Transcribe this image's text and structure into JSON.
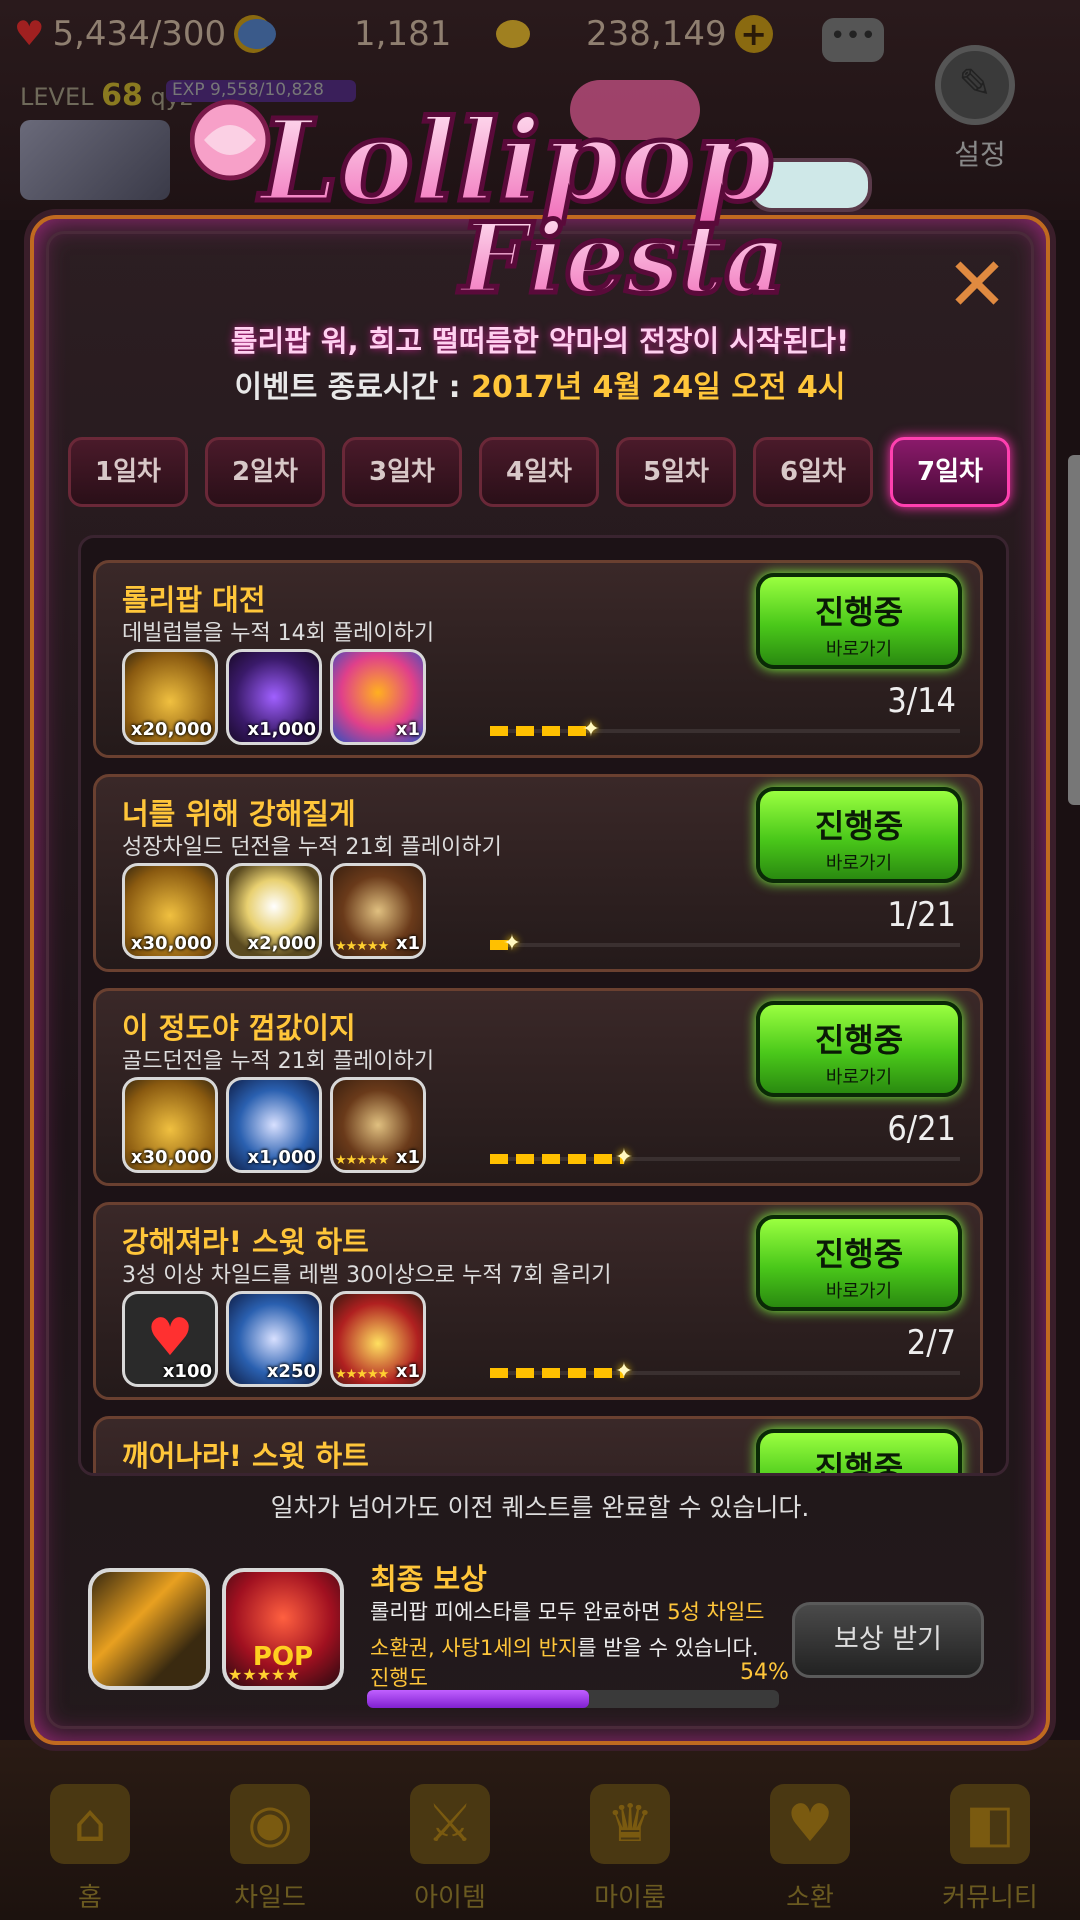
{
  "hud": {
    "hearts": "5,434/300",
    "gems": "1,181",
    "gold": "238,149",
    "level_label": "LEVEL",
    "level": "68",
    "username": "qyz",
    "exp": "EXP 9,558/10,828",
    "settings_label": "설정"
  },
  "event": {
    "logo_line1": "Lollipop",
    "logo_line2": "Fiesta",
    "subtitle": "롤리팝 워, 희고 떨떠름한 악마의 전장이 시작된다!",
    "end_label": "이벤트 종료시간 : ",
    "end_time": "2017년 4월 24일 오전 4시",
    "close_symbol": "✕",
    "days": [
      "1일차",
      "2일차",
      "3일차",
      "4일차",
      "5일차",
      "6일차",
      "7일차"
    ],
    "active_day_index": 6,
    "quests": [
      {
        "title": "롤리팝 대전",
        "desc": "데빌럼블을 누적 14회 플레이하기",
        "rewards": [
          {
            "icon": "gold-coins-icon",
            "qty": "x20,000"
          },
          {
            "icon": "purple-crystal-icon",
            "qty": "x1,000"
          },
          {
            "icon": "character-icon",
            "qty": "x1"
          }
        ],
        "button": "진행중",
        "button_sub": "바로가기",
        "current": 3,
        "total": 14,
        "progress_text": "3/14"
      },
      {
        "title": "너를 위해 강해질게",
        "desc": "성장차일드 던전을 누적 21회 플레이하기",
        "rewards": [
          {
            "icon": "gold-coins-icon",
            "qty": "x30,000"
          },
          {
            "icon": "silver-stone-icon",
            "qty": "x2,000"
          },
          {
            "icon": "ring-icon",
            "qty": "x1",
            "stars": "★★★★★"
          }
        ],
        "button": "진행중",
        "button_sub": "바로가기",
        "current": 1,
        "total": 21,
        "progress_text": "1/21"
      },
      {
        "title": "이 정도야 껌값이지",
        "desc": "골드던전을 누적 21회 플레이하기",
        "rewards": [
          {
            "icon": "gold-coins-icon",
            "qty": "x30,000"
          },
          {
            "icon": "blue-medal-icon",
            "qty": "x1,000"
          },
          {
            "icon": "ring-icon",
            "qty": "x1",
            "stars": "★★★★★"
          }
        ],
        "button": "진행중",
        "button_sub": "바로가기",
        "current": 6,
        "total": 21,
        "progress_text": "6/21"
      },
      {
        "title": "강해져라! 스윗 하트",
        "desc": "3성 이상 차일드를 레벨 30이상으로 누적 7회 올리기",
        "rewards": [
          {
            "icon": "heart-icon",
            "qty": "x100"
          },
          {
            "icon": "blue-medal-icon",
            "qty": "x250"
          },
          {
            "icon": "treasure-chest-icon",
            "qty": "x1",
            "stars": "★★★★★"
          }
        ],
        "button": "진행중",
        "button_sub": "바로가기",
        "current": 2,
        "total": 7,
        "progress_text": "2/7"
      },
      {
        "title": "깨어나라! 스윗 하트",
        "desc": "",
        "rewards": [],
        "button": "진행중",
        "button_sub": "",
        "current": 0,
        "total": 0,
        "progress_text": ""
      }
    ],
    "note": "일차가 넘어가도 이전 퀘스트를 완료할 수 있습니다.",
    "final": {
      "title": "최종 보상",
      "desc_1": "롤리팝 피에스타를 모두 완료하면 ",
      "desc_hl1": "5성 차일드",
      "desc_hl2": "소환권, 사탕1세의 반지",
      "desc_2": "를 받을 수 있습니다.",
      "progress_label": "진행도",
      "progress_pct_text": "54%",
      "progress": 0.54,
      "ring_badge": "POP",
      "ring_stars": "★★★★★",
      "claim_button": "보상 받기"
    }
  },
  "nav": [
    {
      "label": "홈",
      "icon": "home-icon",
      "glyph": "⌂"
    },
    {
      "label": "차일드",
      "icon": "flame-icon",
      "glyph": "◉"
    },
    {
      "label": "아이템",
      "icon": "sword-shield-icon",
      "glyph": "⚔"
    },
    {
      "label": "마이룸",
      "icon": "crown-icon",
      "glyph": "♛"
    },
    {
      "label": "소환",
      "icon": "potion-icon",
      "glyph": "♥"
    },
    {
      "label": "커뮤니티",
      "icon": "community-shield-icon",
      "glyph": "◧"
    }
  ]
}
